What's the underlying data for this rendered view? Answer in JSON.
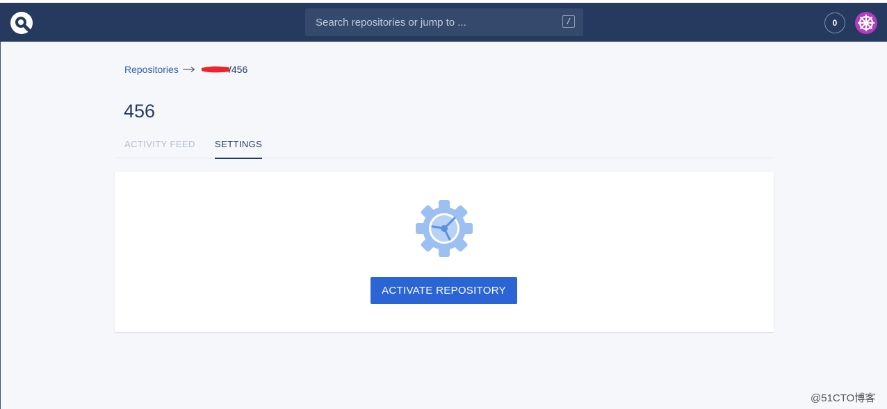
{
  "header": {
    "search": {
      "placeholder": "Search repositories or jump to ...",
      "shortcut_key": "/"
    },
    "notification_count": "0",
    "logo_icon": "drone-logo-icon",
    "avatar_icon": "user-avatar-icon",
    "colors": {
      "navbar": "#253a5e",
      "search_bg": "#34496c"
    }
  },
  "breadcrumb": {
    "root_label": "Repositories",
    "arrow_icon": "arrow-right-icon",
    "repo_suffix": "/456"
  },
  "page": {
    "title": "456",
    "tabs": [
      {
        "label": "ACTIVITY FEED",
        "active": false
      },
      {
        "label": "SETTINGS",
        "active": true
      }
    ]
  },
  "settings_card": {
    "icon": "gear-icon",
    "activate_button_label": "ACTIVATE REPOSITORY",
    "colors": {
      "button": "#2b64d4",
      "gear": "#8fb4ec"
    }
  },
  "watermark": "@51CTO博客"
}
